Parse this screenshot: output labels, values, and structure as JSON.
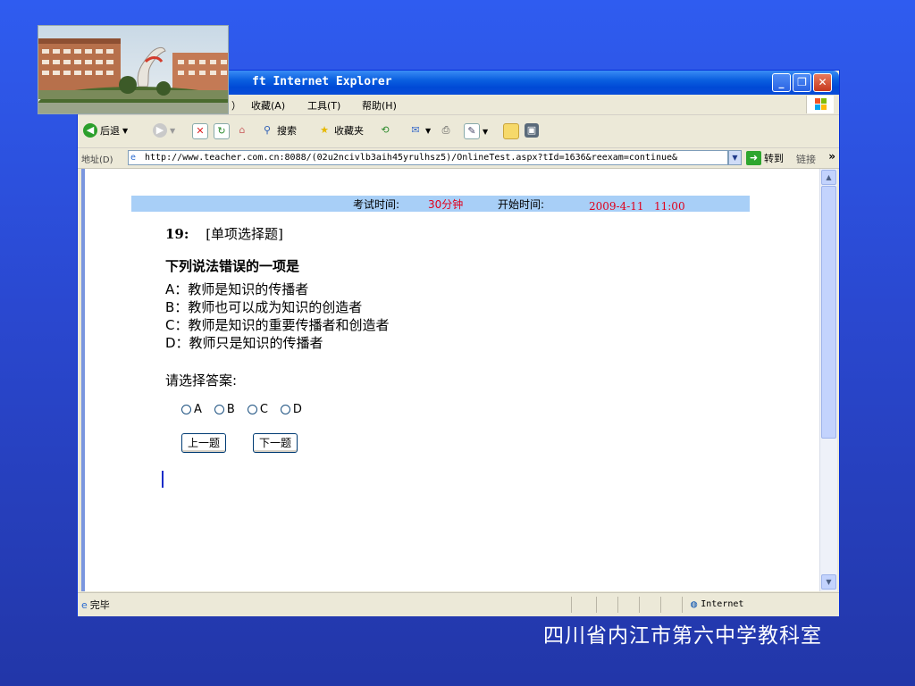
{
  "window": {
    "title": "ft Internet Explorer",
    "min_glyph": "_",
    "max_glyph": "❐",
    "close_glyph": "✕"
  },
  "menu": {
    "items": [
      "）",
      "收藏(A)",
      "工具(T)",
      "帮助(H)"
    ]
  },
  "toolbar": {
    "back_label": "后退",
    "search_label": "搜索",
    "favorites_label": "收藏夹"
  },
  "address": {
    "label": "地址(D)",
    "url": "http://www.teacher.com.cn:8088/(02u2ncivlb3aih45yrulhsz5)/OnlineTest.aspx?tId=1636&reexam=continue&",
    "go_label": "转到",
    "links_label": "链接",
    "more": "»"
  },
  "exam": {
    "time_label": "考试时间:",
    "time_value": "30分钟",
    "start_label": "开始时间:",
    "start_value": "2009-4-11   11:00",
    "question_number": "19:",
    "question_type": "[单项选择题]",
    "question_stem": "下列说法错误的一项是",
    "options": [
      "A：教师是知识的传播者",
      "B：教师也可以成为知识的创造者",
      "C：教师是知识的重要传播者和创造者",
      "D：教师只是知识的传播者"
    ],
    "prompt": "请选择答案:",
    "choices": [
      "A",
      "B",
      "C",
      "D"
    ],
    "prev_button": "上一题",
    "next_button": "下一题"
  },
  "status": {
    "text": "完毕",
    "zone": "Internet"
  },
  "footer": "四川省内江市第六中学教科室",
  "colors": {
    "slide_bg": "#2f5cf0",
    "info_bar": "#a8cff7",
    "highlight_red": "#e0001c",
    "xp_title_blue": "#0049d6"
  }
}
